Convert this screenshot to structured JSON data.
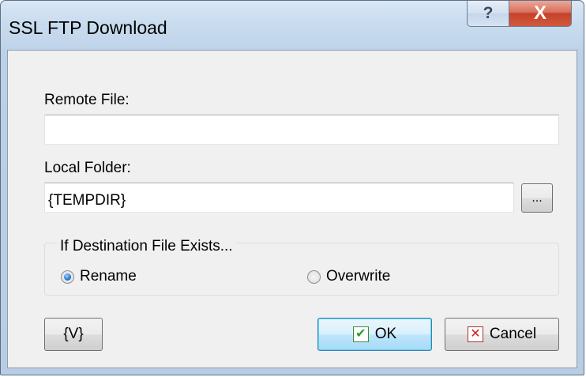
{
  "window": {
    "title": "SSL FTP Download",
    "help_glyph": "?",
    "close_glyph": "X"
  },
  "fields": {
    "remote_file_label": "Remote File:",
    "remote_file_value": "",
    "local_folder_label": "Local Folder:",
    "local_folder_value": "{TEMPDIR}",
    "browse_label": "..."
  },
  "destination_group": {
    "legend": "If Destination File Exists...",
    "options": [
      {
        "label": "Rename",
        "checked": true
      },
      {
        "label": "Overwrite",
        "checked": false
      }
    ]
  },
  "buttons": {
    "variables_label": "{V}",
    "ok_label": "OK",
    "cancel_label": "Cancel"
  },
  "icons": {
    "ok": "checkmark-icon",
    "cancel": "x-mark-icon",
    "help": "question-icon",
    "close": "close-icon"
  },
  "colors": {
    "accent": "#3c7fb1",
    "close_button": "#c5412a"
  }
}
